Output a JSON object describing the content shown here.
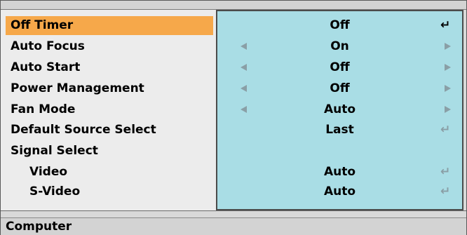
{
  "menu": {
    "items": [
      {
        "label": "Off Timer",
        "value": "Off",
        "selected": true
      },
      {
        "label": "Auto Focus",
        "value": "On"
      },
      {
        "label": "Auto Start",
        "value": "Off"
      },
      {
        "label": "Power Management",
        "value": "Off"
      },
      {
        "label": "Fan Mode",
        "value": "Auto"
      },
      {
        "label": "Default Source Select",
        "value": "Last"
      },
      {
        "label": "Signal Select",
        "value": ""
      },
      {
        "label": "Video",
        "value": "Auto"
      },
      {
        "label": "S-Video",
        "value": "Auto"
      }
    ],
    "icons": {
      "enter": "↵",
      "left_arrow": "left-arrow-icon",
      "right_arrow": "right-arrow-icon"
    }
  },
  "status": {
    "text": "Computer"
  },
  "colors": {
    "selection": "#f6a84a",
    "value_panel": "#a9dde5",
    "background": "#ececec",
    "dim_icon": "#8a9fa6"
  }
}
